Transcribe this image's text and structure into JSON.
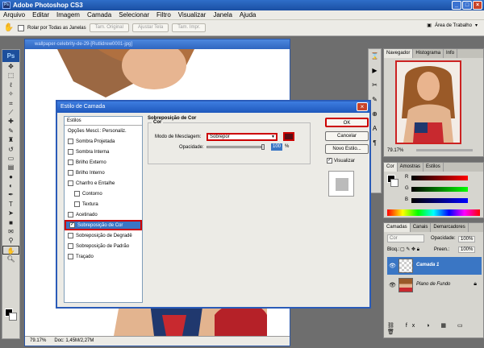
{
  "app": {
    "title": "Adobe Photoshop CS3",
    "logo": "Ps"
  },
  "menu": [
    "Arquivo",
    "Editar",
    "Imagem",
    "Camada",
    "Selecionar",
    "Filtro",
    "Visualizar",
    "Janela",
    "Ajuda"
  ],
  "options_bar": {
    "checkbox_label": "Rolar por Todas as Janelas",
    "buttons": [
      "Tam. Original",
      "Ajustar Tela",
      "Tam. Impr."
    ],
    "workspace_label": "Área de Trabalho"
  },
  "document": {
    "title": "wallpaper-celebrity-de-29-[Rutlidrew0001-jpg]",
    "zoom": "79.17%",
    "doc_size": "Doc: 1,45M/2,27M"
  },
  "dialog": {
    "title": "Estilo de Camada",
    "styles_header": "Estilos",
    "styles": [
      {
        "label": "Opções Mescl.: Personaliz.",
        "checkbox": false,
        "sub": false
      },
      {
        "label": "Sombra Projetada",
        "checkbox": true,
        "sub": false
      },
      {
        "label": "Sombra Interna",
        "checkbox": true,
        "sub": false
      },
      {
        "label": "Brilho Externo",
        "checkbox": true,
        "sub": false
      },
      {
        "label": "Brilho Interno",
        "checkbox": true,
        "sub": false
      },
      {
        "label": "Chanfro e Entalhe",
        "checkbox": true,
        "sub": false
      },
      {
        "label": "Contorno",
        "checkbox": true,
        "sub": true
      },
      {
        "label": "Textura",
        "checkbox": true,
        "sub": true
      },
      {
        "label": "Acetinado",
        "checkbox": true,
        "sub": false
      },
      {
        "label": "Sobreposição de Cor",
        "checkbox": true,
        "sub": false
      },
      {
        "label": "Sobreposição de Degradê",
        "checkbox": true,
        "sub": false
      },
      {
        "label": "Sobreposição de Padrão",
        "checkbox": true,
        "sub": false
      },
      {
        "label": "Traçado",
        "checkbox": true,
        "sub": false
      }
    ],
    "overlay": {
      "section_title": "Sobreposição de Cor",
      "group_title": "Cor",
      "blend_label": "Modo de Mesclagem:",
      "blend_value": "Sobrepor",
      "opacity_label": "Opacidade:",
      "opacity_value": "100",
      "opacity_unit": "%",
      "opacity_level": 1.0,
      "color": "#5a0f16"
    },
    "buttons": {
      "ok": "OK",
      "cancel": "Cancelar",
      "new_style": "Novo Estilo...",
      "preview": "Visualizar"
    }
  },
  "panels": {
    "navigator_tabs": [
      "Navegador",
      "Histograma",
      "Info"
    ],
    "navigator_zoom": "79.17%",
    "color_tabs": [
      "Cor",
      "Amostras",
      "Estilos"
    ],
    "color_channels": [
      "R",
      "G",
      "B"
    ],
    "layers_tabs": [
      "Camadas",
      "Canais",
      "Demarcadores"
    ],
    "layers_blend": "Cor",
    "layers_opacity_label": "Opacidade:",
    "layers_opacity": "100%",
    "layers_lock_label": "Bloq.:",
    "layers_fill_label": "Preen.:",
    "layers_fill": "100%",
    "layers": [
      {
        "name": "Camada 1",
        "selected": true
      },
      {
        "name": "Plano de Fundo",
        "selected": false
      }
    ]
  }
}
